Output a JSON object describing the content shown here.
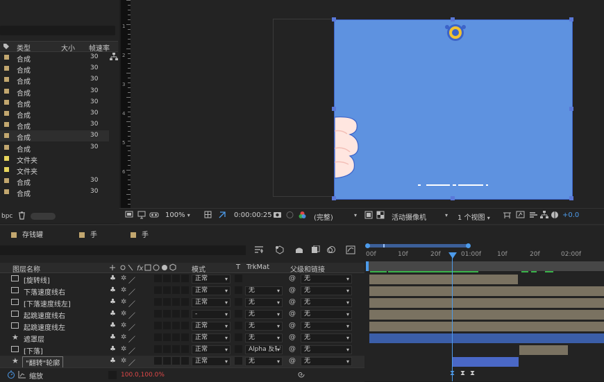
{
  "project": {
    "headers": {
      "type": "类型",
      "size": "大小",
      "fps": "帧速率"
    },
    "rows": [
      {
        "type": "合成",
        "fps": "30",
        "kind": "comp"
      },
      {
        "type": "合成",
        "fps": "30",
        "kind": "comp"
      },
      {
        "type": "合成",
        "fps": "30",
        "kind": "comp"
      },
      {
        "type": "合成",
        "fps": "30",
        "kind": "comp"
      },
      {
        "type": "合成",
        "fps": "30",
        "kind": "comp"
      },
      {
        "type": "合成",
        "fps": "30",
        "kind": "comp"
      },
      {
        "type": "合成",
        "fps": "30",
        "kind": "comp"
      },
      {
        "type": "合成",
        "fps": "30",
        "kind": "comp"
      },
      {
        "type": "合成",
        "fps": "30",
        "kind": "comp"
      },
      {
        "type": "文件夹",
        "fps": "",
        "kind": "folder"
      },
      {
        "type": "文件夹",
        "fps": "",
        "kind": "folder"
      },
      {
        "type": "合成",
        "fps": "30",
        "kind": "comp"
      },
      {
        "type": "合成",
        "fps": "30",
        "kind": "comp"
      }
    ],
    "bpc_label": "bpc"
  },
  "ruler": {
    "marks": [
      "1",
      "2",
      "3",
      "4",
      "5",
      "6"
    ]
  },
  "comp_toolbar": {
    "zoom": "100%",
    "timecode": "0:00:00:25",
    "resolution": "(完整)",
    "camera": "活动摄像机",
    "views": "1 个视图",
    "exposure": "+0.0"
  },
  "tabs": [
    "存钱罐",
    "手",
    "手"
  ],
  "layers": {
    "headers": {
      "name": "图层名称",
      "mode": "模式",
      "t": "T",
      "trkmat": "TrkMat",
      "parent": "父级和链接"
    },
    "rows": [
      {
        "name": "[旋转线]",
        "mode": "正常",
        "trkmat": "",
        "parent": "无",
        "icon": "comp"
      },
      {
        "name": "下落速度线右",
        "mode": "正常",
        "trkmat": "无",
        "parent": "无",
        "icon": "comp"
      },
      {
        "name": "[下落速度线左]",
        "mode": "正常",
        "trkmat": "无",
        "parent": "无",
        "icon": "comp"
      },
      {
        "name": "起跳速度线右",
        "mode": "-",
        "trkmat": "无",
        "parent": "无",
        "icon": "comp"
      },
      {
        "name": "起跳速度线左",
        "mode": "正常",
        "trkmat": "无",
        "parent": "无",
        "icon": "comp"
      },
      {
        "name": "遮罩层",
        "mode": "正常",
        "trkmat": "无",
        "parent": "无",
        "icon": "star"
      },
      {
        "name": "[下落]",
        "mode": "正常",
        "trkmat": "Alpha 反转",
        "parent": "无",
        "icon": "comp"
      },
      {
        "name": "\"翻转\"轮廓",
        "mode": "正常",
        "trkmat": "无",
        "parent": "无",
        "icon": "star"
      }
    ],
    "property": {
      "name": "缩放",
      "value": "100.0,100.0%"
    }
  },
  "timeline": {
    "ticks": [
      "00f",
      "10f",
      "20f",
      "01:00f",
      "10f",
      "20f",
      "02:00f"
    ]
  },
  "colors": {
    "accent": "#4d9bea",
    "comp_bg": "#5e92e0",
    "label_tan": "#c2a76f",
    "label_yellow": "#e6d45c",
    "track": "#7a7261"
  }
}
